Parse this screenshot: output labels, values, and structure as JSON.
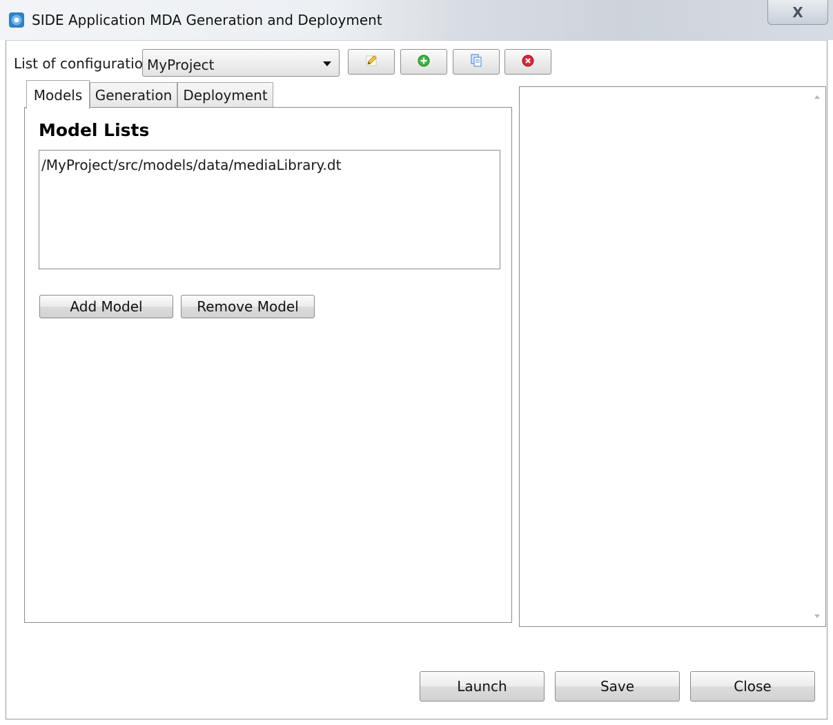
{
  "window": {
    "title": "SIDE Application MDA Generation and Deployment",
    "close_glyph": "X",
    "app_icon": "side-app-icon"
  },
  "config": {
    "label": "List of configuratio",
    "selected": "MyProject",
    "tools": [
      {
        "name": "edit-config",
        "icon": "pencil-icon"
      },
      {
        "name": "add-config",
        "icon": "plus-circle-icon"
      },
      {
        "name": "copy-config",
        "icon": "copy-icon"
      },
      {
        "name": "delete-config",
        "icon": "remove-circle-icon"
      }
    ]
  },
  "tabs": [
    {
      "label": "Models",
      "active": true
    },
    {
      "label": "Generation",
      "active": false
    },
    {
      "label": "Deployment",
      "active": false
    }
  ],
  "models_tab": {
    "section_title": "Model Lists",
    "models": [
      "/MyProject/src/models/data/mediaLibrary.dt"
    ],
    "add_label": "Add Model",
    "remove_label": "Remove Model"
  },
  "footer": {
    "launch_label": "Launch",
    "save_label": "Save",
    "close_label": "Close"
  },
  "colors": {
    "add_green": "#3cb43c",
    "delete_red": "#d8283a",
    "pencil_yellow": "#f3c74a",
    "copy_blue": "#3d7fd8"
  }
}
